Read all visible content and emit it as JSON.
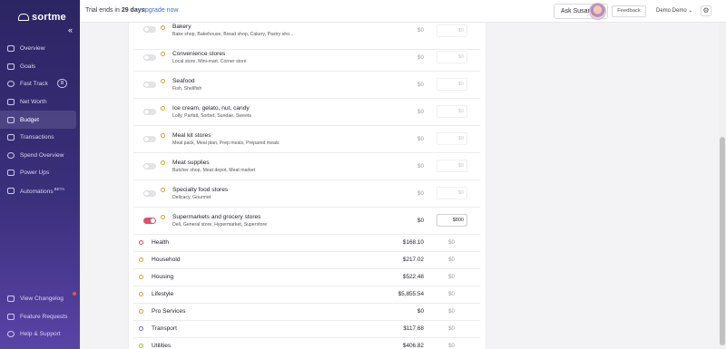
{
  "app": {
    "logo": "sortme"
  },
  "sidebar": {
    "items": [
      {
        "label": "Overview",
        "icon": "overview-icon"
      },
      {
        "label": "Goals",
        "icon": "goals-icon"
      },
      {
        "label": "Fast Track",
        "icon": "fast-track-icon",
        "badge": "8"
      },
      {
        "label": "Net Worth",
        "icon": "net-worth-icon"
      },
      {
        "label": "Budget",
        "icon": "budget-icon",
        "active": true
      },
      {
        "label": "Transactions",
        "icon": "transactions-icon"
      },
      {
        "label": "Spend Overview",
        "icon": "spend-overview-icon"
      },
      {
        "label": "Power Ups",
        "icon": "power-ups-icon"
      },
      {
        "label": "Automations",
        "icon": "automations-icon",
        "sup": "BETA"
      }
    ],
    "bottom": [
      {
        "label": "View Changelog",
        "icon": "changelog-icon"
      },
      {
        "label": "Feature Requests",
        "icon": "feature-requests-icon"
      },
      {
        "label": "Help & Support",
        "icon": "help-icon"
      }
    ]
  },
  "topbar": {
    "trial_prefix": "Trial ends in",
    "trial_days": "29 days",
    "upgrade": "upgrade now",
    "ask": "Ask Susan",
    "feedback": "Feedback",
    "user": "Demo Demo"
  },
  "subcategories": [
    {
      "title": "Bakery",
      "desc": "Bake shop, Bakehouse, Bread shop, Cakery, Pastry sho...",
      "spent": "$0",
      "budget": "$0",
      "enabled": false
    },
    {
      "title": "Convenience stores",
      "desc": "Local store, Mini-mart, Corner store",
      "spent": "$0",
      "budget": "$0",
      "enabled": false
    },
    {
      "title": "Seafood",
      "desc": "Fish, Shellfish",
      "spent": "$0",
      "budget": "$0",
      "enabled": false
    },
    {
      "title": "Ice cream, gelato, nut, candy",
      "desc": "Lolly, Parfait, Sorbet, Sundae, Sweets",
      "spent": "$0",
      "budget": "$0",
      "enabled": false
    },
    {
      "title": "Meal kit stores",
      "desc": "Meal pack, Meal plan, Prep meals, Prepared meals",
      "spent": "$0",
      "budget": "$0",
      "enabled": false
    },
    {
      "title": "Meat supplies",
      "desc": "Butcher shop, Meat depot, Meat market",
      "spent": "$0",
      "budget": "$0",
      "enabled": false
    },
    {
      "title": "Specialty food stores",
      "desc": "Delicacy, Gourmet",
      "spent": "$0",
      "budget": "$0",
      "enabled": false
    },
    {
      "title": "Supermarkets and grocery stores",
      "desc": "Deli, General store, Hypermarket, Superstore",
      "spent": "$0",
      "budget": "$800",
      "enabled": true
    }
  ],
  "categories": [
    {
      "name": "Health",
      "spent": "$168.10",
      "budget": "$0",
      "dot_color": "#d9485f"
    },
    {
      "name": "Household",
      "spent": "$217.02",
      "budget": "$0",
      "dot_color": "#c9a62a"
    },
    {
      "name": "Housing",
      "spent": "$522.48",
      "budget": "$0",
      "dot_color": "#c9a62a"
    },
    {
      "name": "Lifestyle",
      "spent": "$5,855.54",
      "budget": "$0",
      "dot_color": "#c9a62a"
    },
    {
      "name": "Pro Services",
      "spent": "$0",
      "budget": "$0",
      "dot_color": "#c9a62a"
    },
    {
      "name": "Transport",
      "spent": "$117.68",
      "budget": "$0",
      "dot_color": "#7a6fd0"
    },
    {
      "name": "Utilities",
      "spent": "$406.82",
      "budget": "$0",
      "dot_color": "#c9a62a"
    }
  ]
}
